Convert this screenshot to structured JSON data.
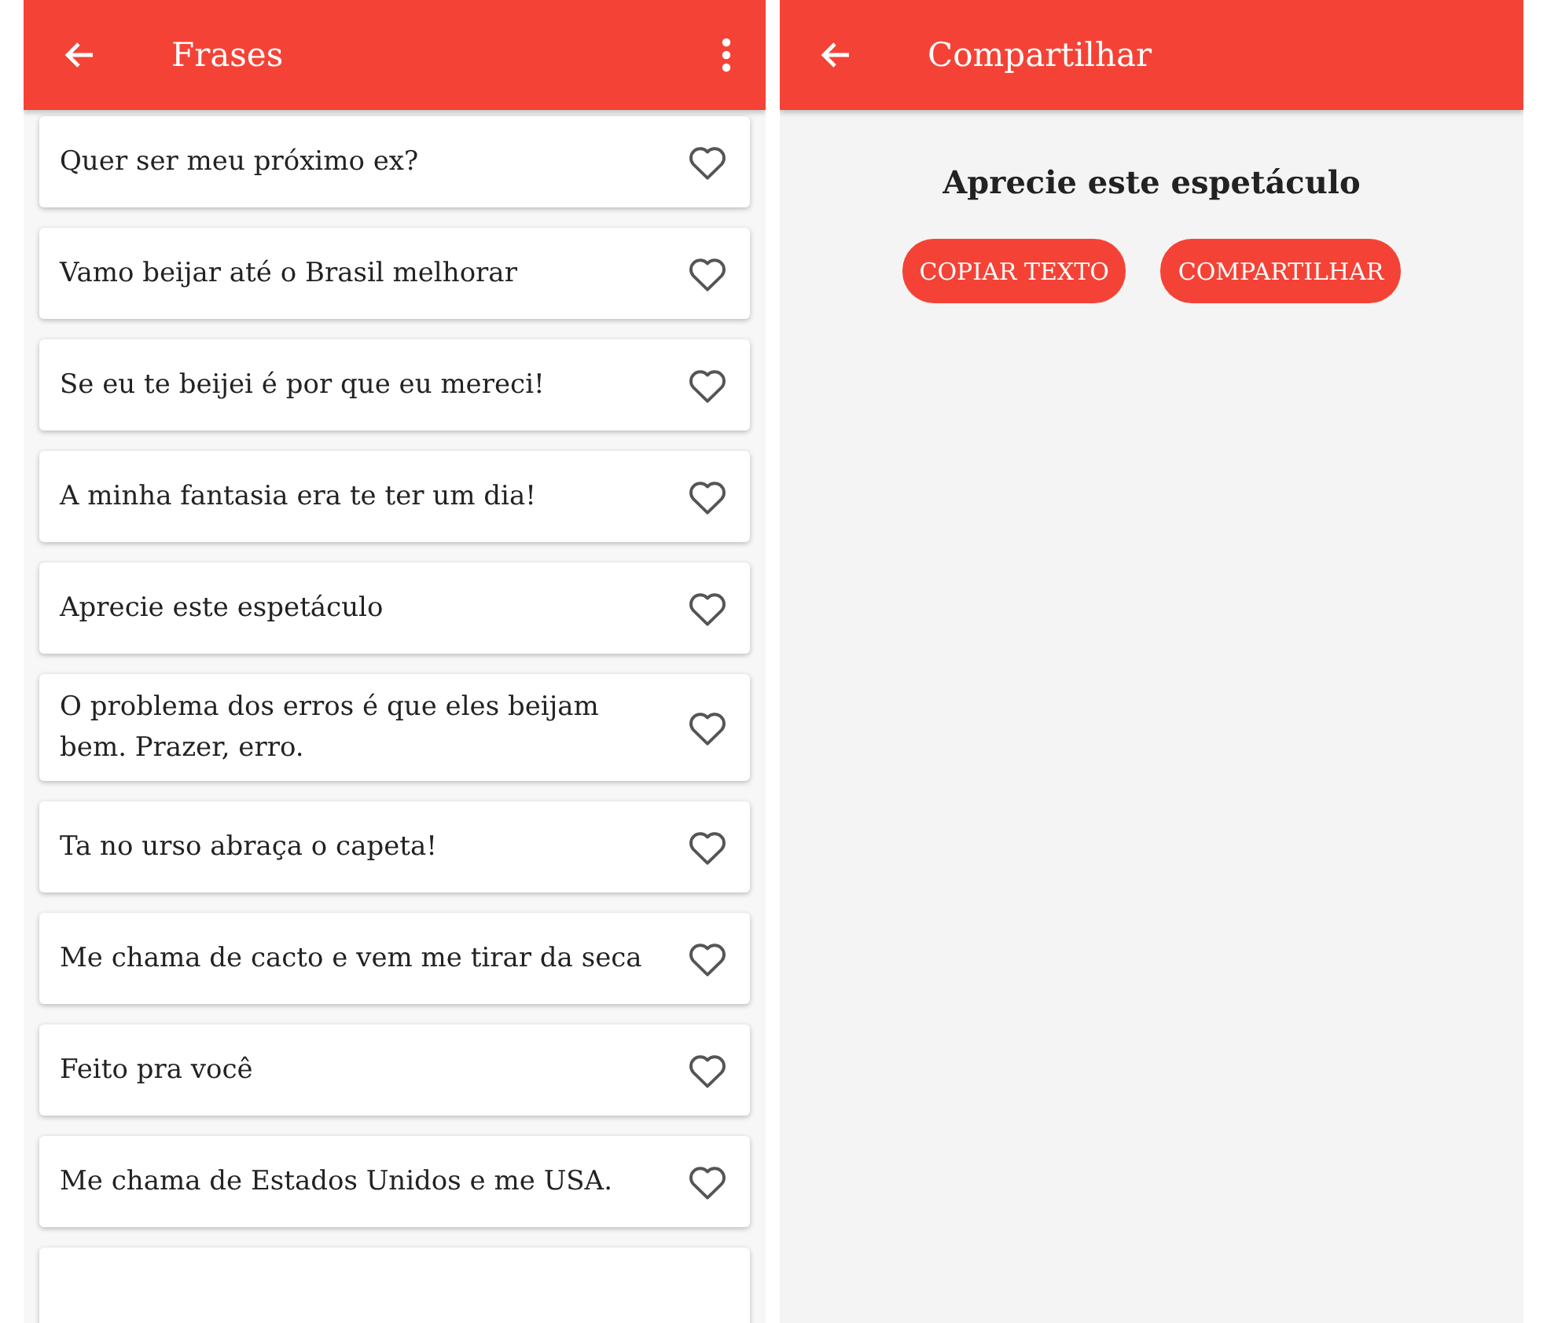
{
  "left_screen": {
    "app_bar": {
      "title": "Frases"
    },
    "phrases": [
      {
        "text": "Quer ser meu próximo ex?",
        "favorite": false
      },
      {
        "text": "Vamo beijar até o Brasil melhorar",
        "favorite": false
      },
      {
        "text": "Se eu te beijei é por que eu mereci!",
        "favorite": false
      },
      {
        "text": "A minha fantasia era te ter um dia!",
        "favorite": false
      },
      {
        "text": "Aprecie este espetáculo",
        "favorite": false
      },
      {
        "text": "O problema dos erros é que eles beijam bem. Prazer, erro.",
        "favorite": false
      },
      {
        "text": "Ta no urso abraça o capeta!",
        "favorite": false
      },
      {
        "text": "Me chama de cacto e vem me tirar da seca",
        "favorite": false
      },
      {
        "text": "Feito pra você",
        "favorite": false
      },
      {
        "text": "Me chama de Estados Unidos e me USA.",
        "favorite": false
      }
    ]
  },
  "right_screen": {
    "app_bar": {
      "title": "Compartilhar"
    },
    "phrase": "Aprecie este espetáculo",
    "buttons": [
      "COPIAR TEXTO",
      "COMPARTILHAR"
    ]
  }
}
